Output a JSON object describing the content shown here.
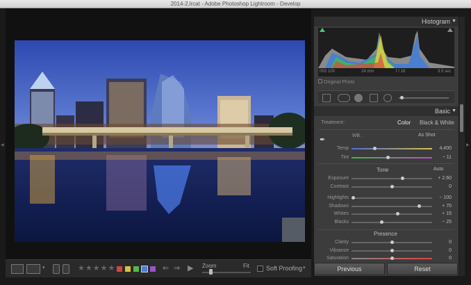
{
  "window": {
    "title": "2014-2.lrcat - Adobe Photoshop Lightroom - Develop"
  },
  "toolbar": {
    "zoom_label": "Zoom",
    "fit_label": "Fit",
    "soft_proofing_label": "Soft Proofing",
    "rating_stars": "★★★★★",
    "color_labels": [
      "#d0463c",
      "#d8c23a",
      "#58b548",
      "#4d7fd0",
      "#9a53c8"
    ]
  },
  "panel": {
    "histogram_title": "Histogram",
    "histogram_info": [
      "ISO 100",
      "24 mm",
      "f / 16",
      "3.5 sec"
    ],
    "original_photo": "Original Photo",
    "basic_title": "Basic",
    "treatment_label": "Treatment :",
    "treatment_color": "Color",
    "treatment_bw": "Black & White",
    "wb_label": "WB :",
    "wb_value": "As Shot",
    "temp": {
      "label": "Temp",
      "value": "4,400",
      "level": 0.28
    },
    "tint": {
      "label": "Tint",
      "value": "− 11",
      "level": 0.45
    },
    "tone_title": "Tone",
    "tone_auto": "Auto",
    "exposure": {
      "label": "Exposure",
      "value": "+ 2.60",
      "level": 0.63
    },
    "contrast": {
      "label": "Contrast",
      "value": "0",
      "level": 0.5
    },
    "highlights": {
      "label": "Highlights",
      "value": "− 100",
      "level": 0.0
    },
    "shadows": {
      "label": "Shadows",
      "value": "+ 70",
      "level": 0.85
    },
    "whites": {
      "label": "Whites",
      "value": "+ 15",
      "level": 0.57
    },
    "blacks": {
      "label": "Blacks",
      "value": "− 25",
      "level": 0.37
    },
    "presence_title": "Presence",
    "clarity": {
      "label": "Clarity",
      "value": "0",
      "level": 0.5
    },
    "vibrance": {
      "label": "Vibrance",
      "value": "0",
      "level": 0.5
    },
    "saturation": {
      "label": "Saturation",
      "value": "0",
      "level": 0.5
    },
    "previous_button": "Previous",
    "reset_button": "Reset"
  }
}
